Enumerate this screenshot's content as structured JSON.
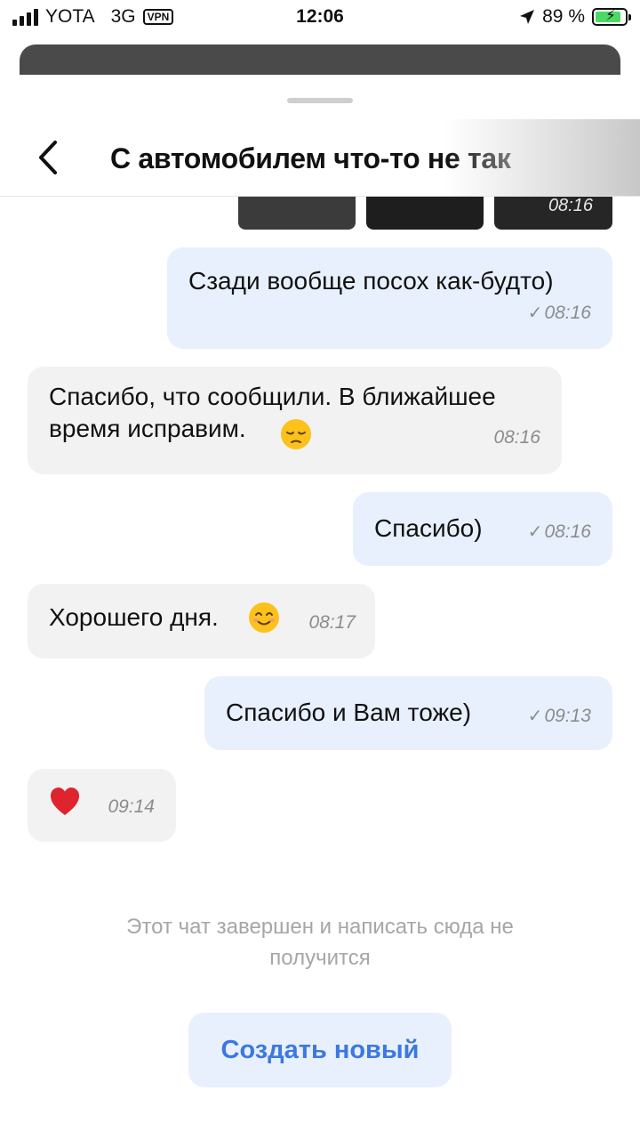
{
  "status_bar": {
    "carrier": "YOTA",
    "network": "3G",
    "vpn": "VPN",
    "time": "12:06",
    "battery_percent": "89 %",
    "battery_level": 0.89
  },
  "header": {
    "title": "С автомобилем что-то не так"
  },
  "photos": {
    "time": "08:16"
  },
  "messages": [
    {
      "direction": "out",
      "text": "Сзади вообще посох как-будто)",
      "time": "08:16",
      "check": "✓"
    },
    {
      "direction": "in",
      "text": "Спасибо, что сообщили. В ближайшее время исправим.",
      "emoji": "pensive-face",
      "time": "08:16"
    },
    {
      "direction": "out",
      "text": "Спасибо)",
      "time": "08:16",
      "check": "✓"
    },
    {
      "direction": "in",
      "text": "Хорошего дня.",
      "emoji": "smiling-face",
      "time": "08:17"
    },
    {
      "direction": "out",
      "text": "Спасибо и Вам тоже)",
      "time": "09:13",
      "check": "✓"
    },
    {
      "direction": "in",
      "emoji": "red-heart",
      "time": "09:14"
    }
  ],
  "footer": {
    "ended_text": "Этот чат завершен и написать сюда не получится",
    "create_button": "Создать новый"
  },
  "colors": {
    "outgoing_bubble": "#e8f0fd",
    "incoming_bubble": "#f2f2f2",
    "accent": "#3d78e0"
  }
}
